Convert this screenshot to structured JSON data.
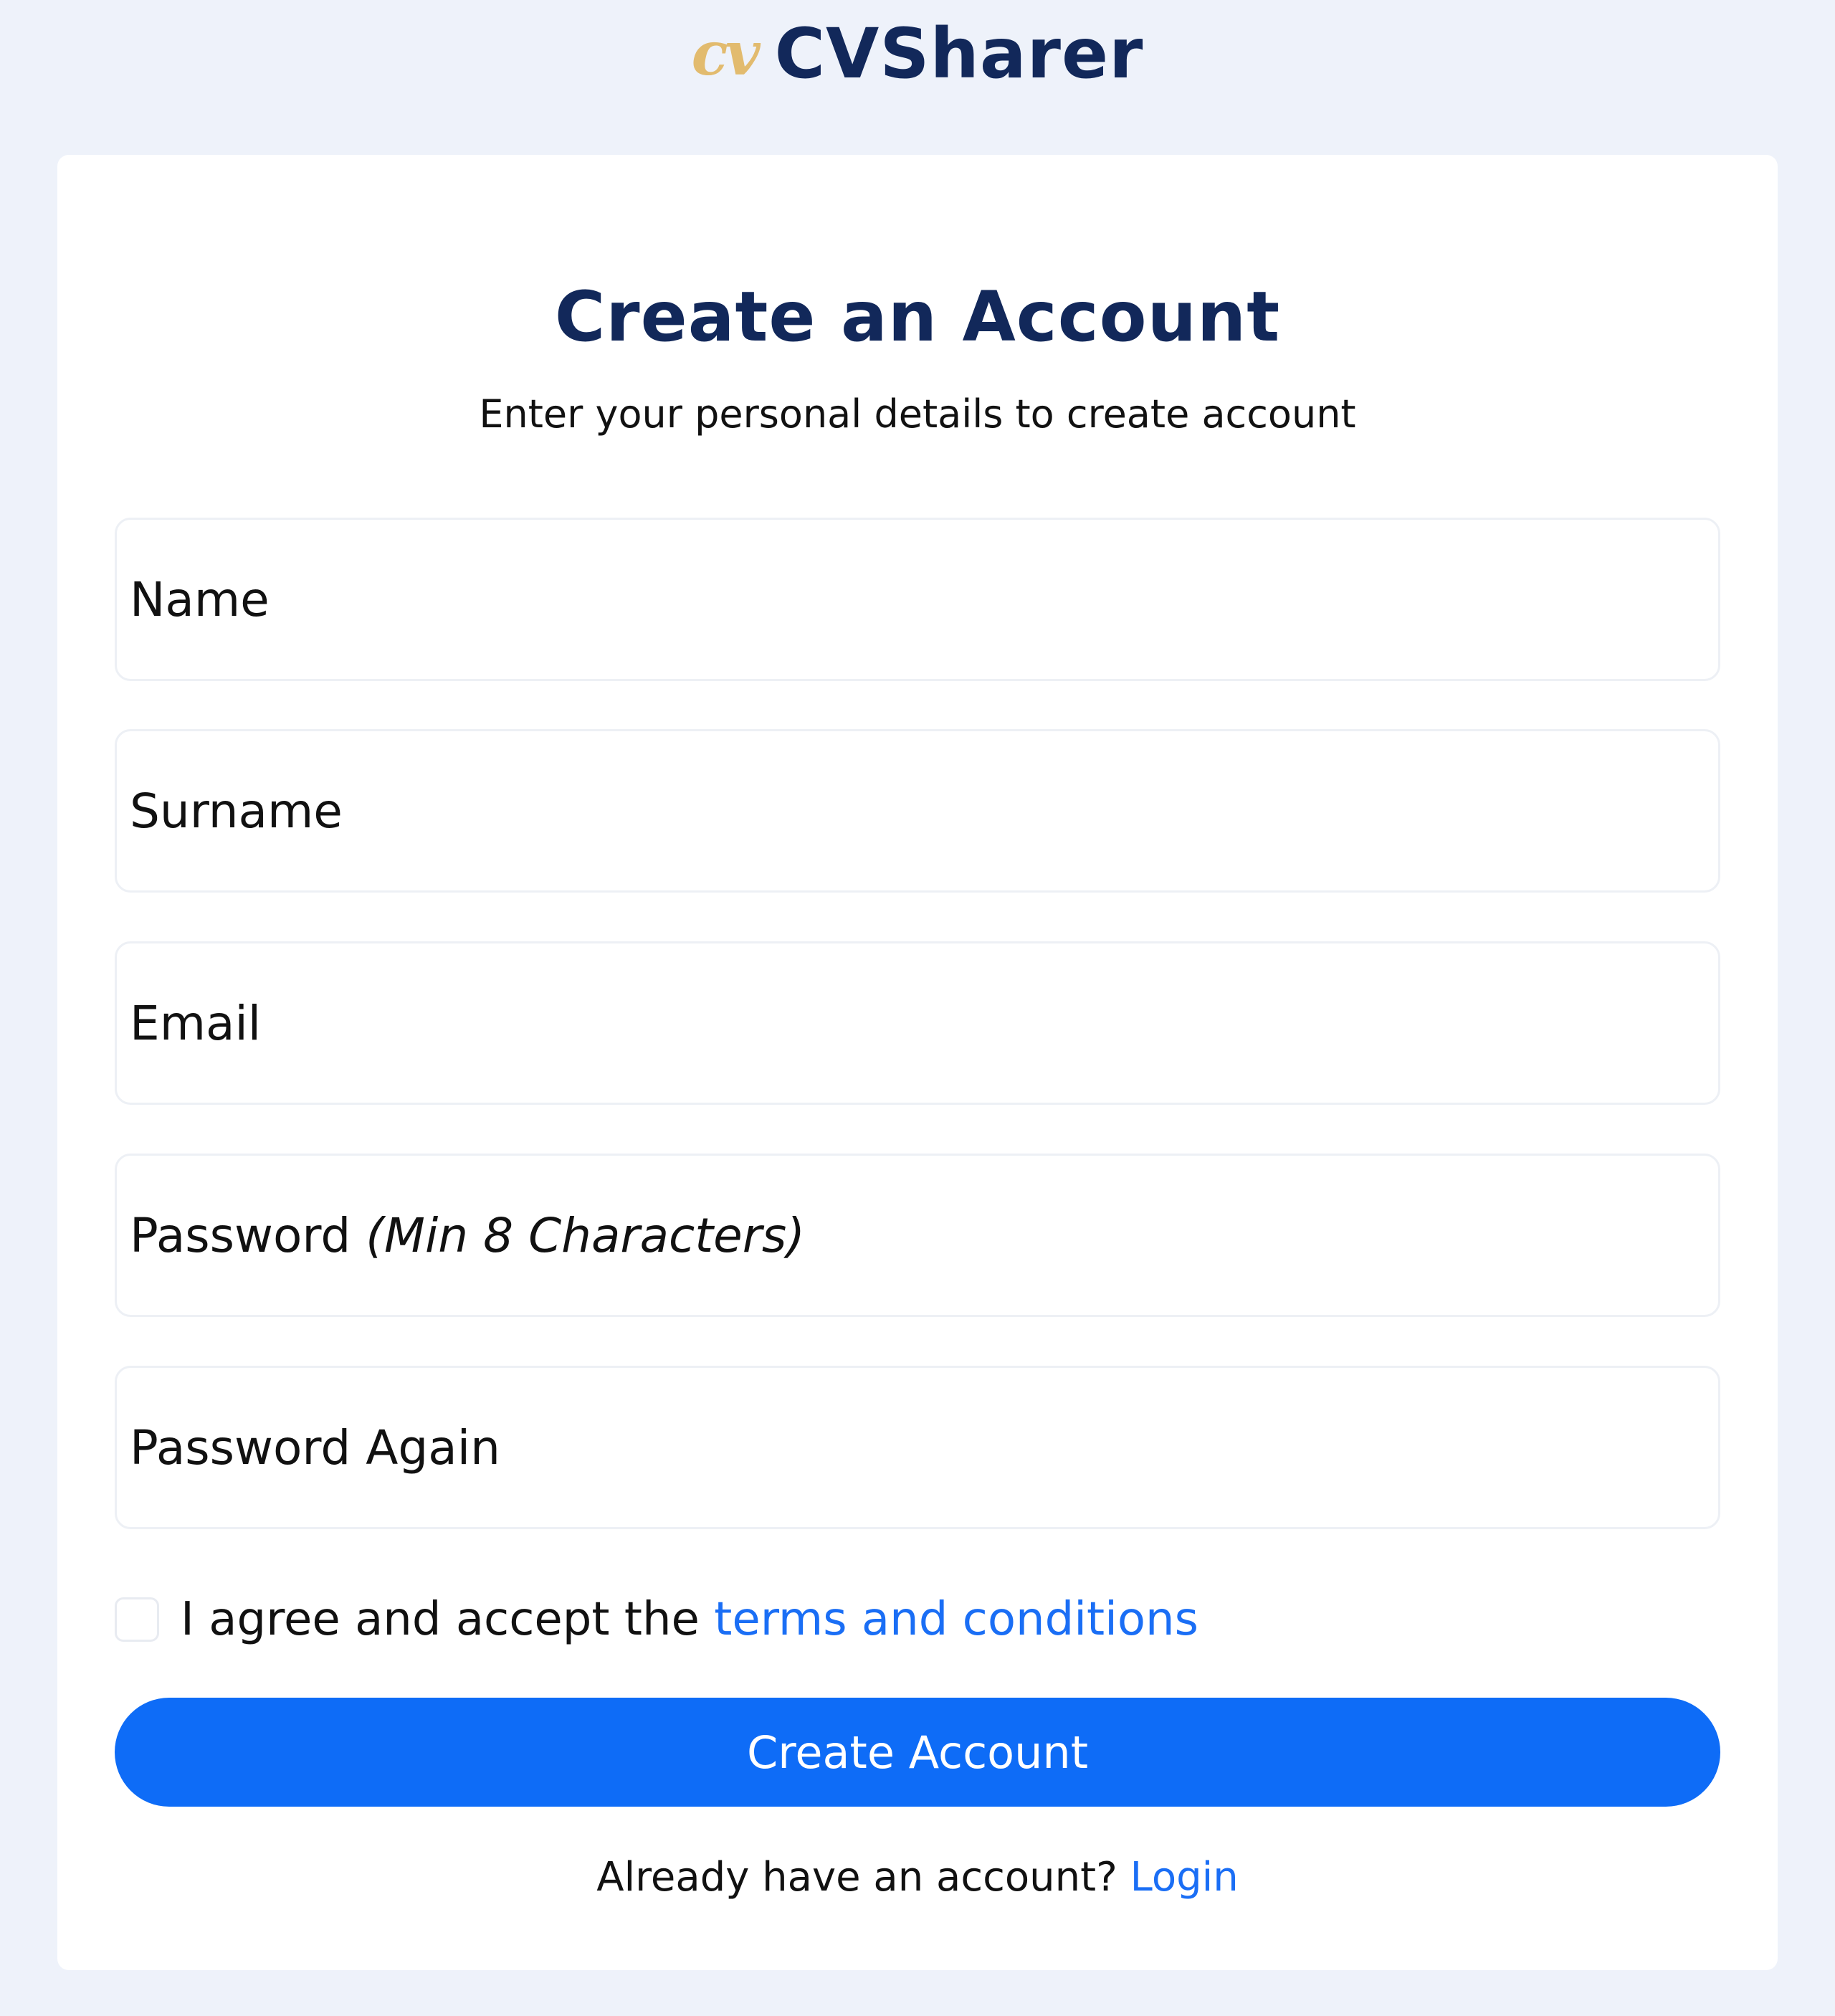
{
  "brand": {
    "logo": "cv",
    "name": "CVSharer"
  },
  "form": {
    "title": "Create an Account",
    "subtitle": "Enter your personal details to create account",
    "fields": {
      "name": "Name",
      "surname": "Surname",
      "email": "Email",
      "password": "Password",
      "password_hint": "(Min 8 Characters)",
      "password_again": "Password Again"
    },
    "terms": {
      "text": "I agree and accept the",
      "link": "terms and conditions"
    },
    "submit_label": "Create Account",
    "login": {
      "text": "Already have an account?",
      "link": "Login"
    }
  },
  "colors": {
    "background": "#eef2fa",
    "card": "#ffffff",
    "heading": "#12285a",
    "accent": "#0e6cf7",
    "link": "#1a6ef5",
    "logo": "#e2bb6e"
  }
}
